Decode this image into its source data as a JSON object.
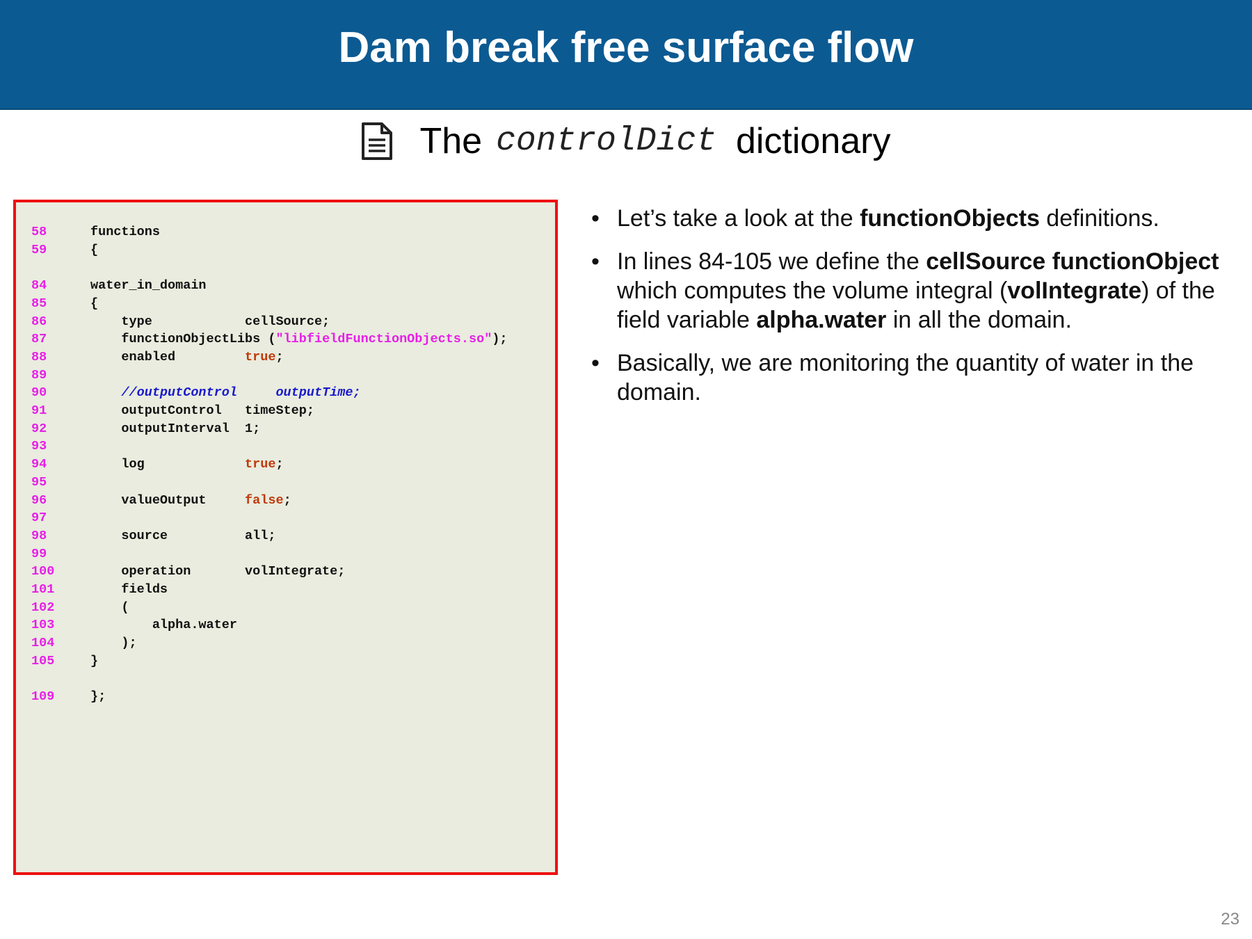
{
  "header": {
    "title": "Dam break free surface flow"
  },
  "subtitle": {
    "icon": "document-icon",
    "prefix": "The",
    "mono": "controlDict",
    "suffix": "dictionary"
  },
  "code": {
    "lines": [
      {
        "num": "58",
        "parts": [
          {
            "t": "functions",
            "c": ""
          }
        ],
        "indent": 0
      },
      {
        "num": "59",
        "parts": [
          {
            "t": "{",
            "c": ""
          }
        ],
        "indent": 0
      },
      {
        "num": "",
        "parts": [],
        "indent": 0
      },
      {
        "num": "84",
        "parts": [
          {
            "t": "water_in_domain",
            "c": ""
          }
        ],
        "indent": 0
      },
      {
        "num": "85",
        "parts": [
          {
            "t": "{",
            "c": ""
          }
        ],
        "indent": 0
      },
      {
        "num": "86",
        "parts": [
          {
            "t": "    type            cellSource;",
            "c": ""
          }
        ],
        "indent": 0
      },
      {
        "num": "87",
        "parts": [
          {
            "t": "    functionObjectLibs (",
            "c": ""
          },
          {
            "t": "\"libfieldFunctionObjects.so\"",
            "c": "str"
          },
          {
            "t": ");",
            "c": ""
          }
        ],
        "indent": 0
      },
      {
        "num": "88",
        "parts": [
          {
            "t": "    enabled         ",
            "c": ""
          },
          {
            "t": "true",
            "c": "kw"
          },
          {
            "t": ";",
            "c": ""
          }
        ],
        "indent": 0
      },
      {
        "num": "89",
        "parts": [],
        "indent": 0
      },
      {
        "num": "90",
        "parts": [
          {
            "t": "    //outputControl     outputTime;",
            "c": "cm"
          }
        ],
        "indent": 0
      },
      {
        "num": "91",
        "parts": [
          {
            "t": "    outputControl   timeStep;",
            "c": ""
          }
        ],
        "indent": 0
      },
      {
        "num": "92",
        "parts": [
          {
            "t": "    outputInterval  1;",
            "c": ""
          }
        ],
        "indent": 0
      },
      {
        "num": "93",
        "parts": [],
        "indent": 0
      },
      {
        "num": "94",
        "parts": [
          {
            "t": "    log             ",
            "c": ""
          },
          {
            "t": "true",
            "c": "kw"
          },
          {
            "t": ";",
            "c": ""
          }
        ],
        "indent": 0
      },
      {
        "num": "95",
        "parts": [],
        "indent": 0
      },
      {
        "num": "96",
        "parts": [
          {
            "t": "    valueOutput     ",
            "c": ""
          },
          {
            "t": "false",
            "c": "kw"
          },
          {
            "t": ";",
            "c": ""
          }
        ],
        "indent": 0
      },
      {
        "num": "97",
        "parts": [],
        "indent": 0
      },
      {
        "num": "98",
        "parts": [
          {
            "t": "    source          all;",
            "c": ""
          }
        ],
        "indent": 0
      },
      {
        "num": "99",
        "parts": [],
        "indent": 0
      },
      {
        "num": "100",
        "parts": [
          {
            "t": "    operation       volIntegrate;",
            "c": ""
          }
        ],
        "indent": 0
      },
      {
        "num": "101",
        "parts": [
          {
            "t": "    fields",
            "c": ""
          }
        ],
        "indent": 0
      },
      {
        "num": "102",
        "parts": [
          {
            "t": "    (",
            "c": ""
          }
        ],
        "indent": 0
      },
      {
        "num": "103",
        "parts": [
          {
            "t": "        alpha.water",
            "c": ""
          }
        ],
        "indent": 0
      },
      {
        "num": "104",
        "parts": [
          {
            "t": "    );",
            "c": ""
          }
        ],
        "indent": 0
      },
      {
        "num": "105",
        "parts": [
          {
            "t": "}",
            "c": ""
          }
        ],
        "indent": 0
      },
      {
        "num": "",
        "parts": [],
        "indent": 0
      },
      {
        "num": "109",
        "parts": [
          {
            "t": "};",
            "c": ""
          }
        ],
        "indent": 0
      }
    ]
  },
  "bullets": [
    [
      {
        "t": "Let’s take a look at the ",
        "b": false
      },
      {
        "t": "functionObjects",
        "b": true
      },
      {
        "t": " definitions.",
        "b": false
      }
    ],
    [
      {
        "t": "In lines 84-105 we define the ",
        "b": false
      },
      {
        "t": "cellSource functionObject",
        "b": true
      },
      {
        "t": " which computes the volume integral (",
        "b": false
      },
      {
        "t": "volIntegrate",
        "b": true
      },
      {
        "t": ") of the field variable ",
        "b": false
      },
      {
        "t": "alpha.water",
        "b": true
      },
      {
        "t": " in all the domain.",
        "b": false
      }
    ],
    [
      {
        "t": "Basically, we are monitoring the quantity of water in the domain.",
        "b": false
      }
    ]
  ],
  "bullet_marker": "•",
  "page_number": "23",
  "colors": {
    "header_bg": "#0c5a92",
    "panel_bg": "#e9ecde",
    "panel_border": "#ee1111",
    "line_number": "#e81ee8",
    "keyword": "#c0390b",
    "string": "#e81ee8",
    "comment": "#1a1acc"
  }
}
